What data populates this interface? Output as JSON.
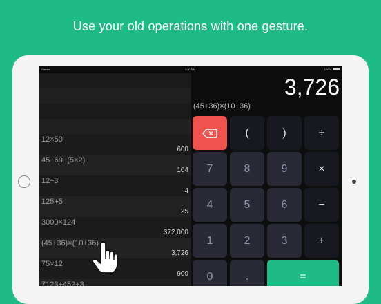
{
  "headline": "Use your old operations with one gesture.",
  "status_bar": {
    "carrier": "Carrier",
    "time": "3:20 PM",
    "battery": "100%"
  },
  "history": [
    {
      "expression": "12×50",
      "result": "600"
    },
    {
      "expression": "45+69−(5×2)",
      "result": "104"
    },
    {
      "expression": "12÷3",
      "result": "4"
    },
    {
      "expression": "125+5",
      "result": "25"
    },
    {
      "expression": "3000×124",
      "result": "372,000"
    },
    {
      "expression": "(45+36)×(10+36)",
      "result": "3,726"
    },
    {
      "expression": "75×12",
      "result": "900"
    },
    {
      "expression": "7123+452+3",
      "result": ""
    }
  ],
  "display": {
    "value": "3,726",
    "expression": "(45+36)×(10+36)"
  },
  "keys": {
    "open_paren": "(",
    "close_paren": ")",
    "divide": "÷",
    "seven": "7",
    "eight": "8",
    "nine": "9",
    "multiply": "×",
    "four": "4",
    "five": "5",
    "six": "6",
    "minus": "−",
    "one": "1",
    "two": "2",
    "three": "3",
    "plus": "+",
    "zero": "0",
    "decimal": ".",
    "equals": "="
  },
  "icons": {
    "delete": "backspace-icon",
    "hand": "pointing-hand-icon"
  },
  "colors": {
    "brand_green": "#1fbb87",
    "delete_red": "#f0524d"
  }
}
